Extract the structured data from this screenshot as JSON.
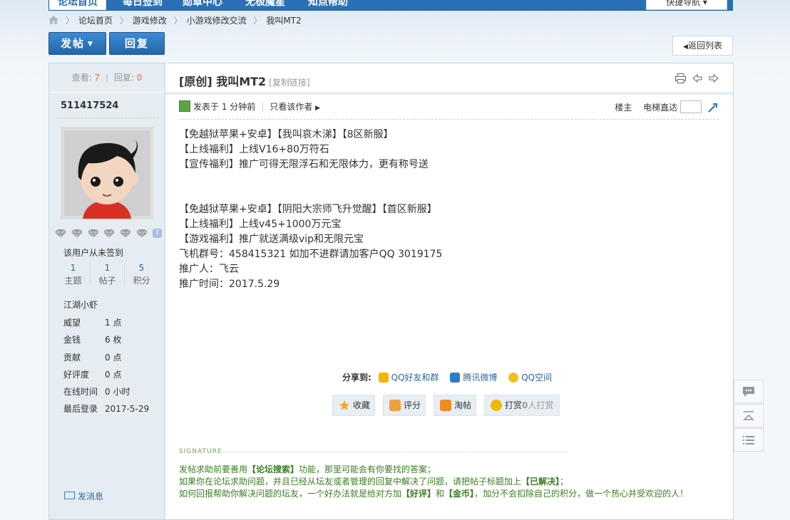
{
  "nav": {
    "tabs": [
      "论坛首页",
      "每日签到",
      "勋章中心",
      "无极魔星",
      "知点帮助"
    ],
    "quick_nav": "快捷导航"
  },
  "breadcrumb": [
    "论坛首页",
    "游戏修改",
    "小游戏修改交流",
    "我叫MT2"
  ],
  "toolbar": {
    "post_label": "发帖",
    "reply_label": "回复",
    "back_label": "返回列表"
  },
  "stats": {
    "views_label": "查看:",
    "views": "7",
    "replies_label": "回复:",
    "replies": "0"
  },
  "author": {
    "name": "511417524",
    "not_signed": "该用户从未签到",
    "counts": [
      {
        "value": "1",
        "label": "主题"
      },
      {
        "value": "1",
        "label": "帖子"
      },
      {
        "value": "5",
        "label": "积分"
      }
    ],
    "rank": "江湖小虾",
    "fields": [
      {
        "key": "威望",
        "value": "1 点"
      },
      {
        "key": "金钱",
        "value": "6 枚"
      },
      {
        "key": "贡献",
        "value": "0 点"
      },
      {
        "key": "好评度",
        "value": "0 点"
      },
      {
        "key": "在线时间",
        "value": "0 小时"
      },
      {
        "key": "最后登录",
        "value": "2017-5-29"
      }
    ],
    "send_message": "发消息"
  },
  "post": {
    "title": "[原创] 我叫MT2",
    "copy_link": "[复制链接]",
    "posted": "发表于 1 分钟前",
    "only_author": "只看该作者",
    "floor": "楼主",
    "elevator": "电梯直达",
    "lines": [
      "【免越狱苹果+安卓】【我叫哀木涕】【8区新服】",
      "【上线福利】上线V16+80万符石",
      "【宣传福利】推广可得无限浮石和无限体力，更有称号送",
      "",
      "",
      "【免越狱苹果+安卓】【阴阳大宗师飞升觉醒】【首区新服】",
      "【上线福利】上线v45+1000万元宝",
      "【游戏福利】推广就送满级vip和无限元宝",
      "飞机群号：458415321   如加不进群请加客户QQ 3019175",
      "推广人：飞云",
      "推广时间：2017.5.29"
    ]
  },
  "share": {
    "label": "分享到:",
    "items": [
      "QQ好友和群",
      "腾讯微博",
      "QQ空间"
    ]
  },
  "actions": {
    "favorite": "收藏",
    "rate": "评分",
    "taobao": "淘帖",
    "tip_prefix": "打赏",
    "tip_count": "0",
    "tip_suffix": "人打赏"
  },
  "signature": {
    "heading": "SIGNATURE",
    "line1_a": "发帖求助前要善用",
    "line1_b": "【论坛搜索】",
    "line1_c": "功能，那里可能会有你要找的答案；",
    "line2_a": "如果你在论坛求助问题，并且已经从坛友或者管理的回复中解决了问题，请把帖子标题加上",
    "line2_b": "【已解决】",
    "line2_c": "；",
    "line3_a": "如何回报帮助你解决问题的坛友，一个好办法就是给对方加",
    "line3_b": "【好评】",
    "line3_c": "和",
    "line3_d": "【金币】",
    "line3_e": "，加分不会扣除自己的积分，做一个热心并受欢迎的人！"
  },
  "colors": {
    "brand": "#2b70b6",
    "sidebar_bg": "#e5edf2",
    "link": "#336699",
    "signature_green": "#3b7d23",
    "stat_red": "#f26c4f"
  }
}
